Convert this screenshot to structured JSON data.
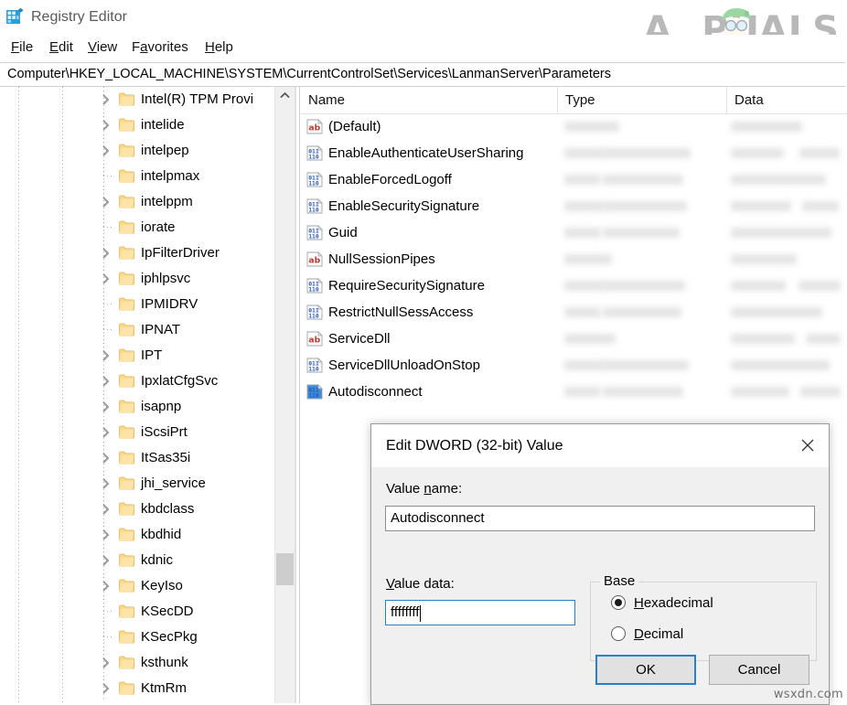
{
  "window": {
    "title": "Registry Editor",
    "icon": "registry-editor-icon"
  },
  "watermark": {
    "brand": "A PUALS",
    "brand_prefix": "A",
    "brand_suffix": "PUALS",
    "footer": "wsxdn.com"
  },
  "menubar": [
    {
      "label": "File",
      "accel": "F"
    },
    {
      "label": "Edit",
      "accel": "E"
    },
    {
      "label": "View",
      "accel": "V"
    },
    {
      "label": "Favorites",
      "accel": "a"
    },
    {
      "label": "Help",
      "accel": "H"
    }
  ],
  "address": {
    "path": "Computer\\HKEY_LOCAL_MACHINE\\SYSTEM\\CurrentControlSet\\Services\\LanmanServer\\Parameters"
  },
  "tree": {
    "items": [
      {
        "label": "Intel(R) TPM Provi",
        "expandable": true
      },
      {
        "label": "intelide",
        "expandable": true
      },
      {
        "label": "intelpep",
        "expandable": true
      },
      {
        "label": "intelpmax",
        "expandable": false
      },
      {
        "label": "intelppm",
        "expandable": true
      },
      {
        "label": "iorate",
        "expandable": false
      },
      {
        "label": "IpFilterDriver",
        "expandable": true
      },
      {
        "label": "iphlpsvc",
        "expandable": true
      },
      {
        "label": "IPMIDRV",
        "expandable": false
      },
      {
        "label": "IPNAT",
        "expandable": false
      },
      {
        "label": "IPT",
        "expandable": true
      },
      {
        "label": "IpxlatCfgSvc",
        "expandable": true
      },
      {
        "label": "isapnp",
        "expandable": true
      },
      {
        "label": "iScsiPrt",
        "expandable": true
      },
      {
        "label": "ItSas35i",
        "expandable": true
      },
      {
        "label": "jhi_service",
        "expandable": true
      },
      {
        "label": "kbdclass",
        "expandable": true
      },
      {
        "label": "kbdhid",
        "expandable": true
      },
      {
        "label": "kdnic",
        "expandable": true
      },
      {
        "label": "KeyIso",
        "expandable": true
      },
      {
        "label": "KSecDD",
        "expandable": false
      },
      {
        "label": "KSecPkg",
        "expandable": false
      },
      {
        "label": "ksthunk",
        "expandable": true
      },
      {
        "label": "KtmRm",
        "expandable": true
      }
    ]
  },
  "list": {
    "columns": [
      "Name",
      "Type",
      "Data"
    ],
    "rows": [
      {
        "name": "(Default)",
        "icon": "string-value-icon",
        "selected": false
      },
      {
        "name": "EnableAuthenticateUserSharing",
        "icon": "dword-value-icon",
        "selected": false
      },
      {
        "name": "EnableForcedLogoff",
        "icon": "dword-value-icon",
        "selected": false
      },
      {
        "name": "EnableSecuritySignature",
        "icon": "dword-value-icon",
        "selected": false
      },
      {
        "name": "Guid",
        "icon": "dword-value-icon",
        "selected": false
      },
      {
        "name": "NullSessionPipes",
        "icon": "string-value-icon",
        "selected": false
      },
      {
        "name": "RequireSecuritySignature",
        "icon": "dword-value-icon",
        "selected": false
      },
      {
        "name": "RestrictNullSessAccess",
        "icon": "dword-value-icon",
        "selected": false
      },
      {
        "name": "ServiceDll",
        "icon": "string-value-icon",
        "selected": false
      },
      {
        "name": "ServiceDllUnloadOnStop",
        "icon": "dword-value-icon",
        "selected": false
      },
      {
        "name": "Autodisconnect",
        "icon": "dword-value-icon",
        "selected": true
      }
    ]
  },
  "dialog": {
    "title": "Edit DWORD (32-bit) Value",
    "close_icon": "close-icon",
    "value_name_label_pre": "Value ",
    "value_name_label_accel": "n",
    "value_name_label_post": "ame:",
    "value_name": "Autodisconnect",
    "value_data_label_accel": "V",
    "value_data_label_post": "alue data:",
    "value_data": "ffffffff",
    "base_label": "Base",
    "base_options": [
      {
        "label_accel": "H",
        "label_post": "exadecimal",
        "selected": true
      },
      {
        "label_accel": "D",
        "label_post": "ecimal",
        "selected": false
      }
    ],
    "ok_label": "OK",
    "cancel_label": "Cancel"
  },
  "colors": {
    "accent": "#2a7fc9",
    "string_icon": "#c0392b",
    "dword_icon": "#2b57b5",
    "selection": "#3a8ddb"
  }
}
